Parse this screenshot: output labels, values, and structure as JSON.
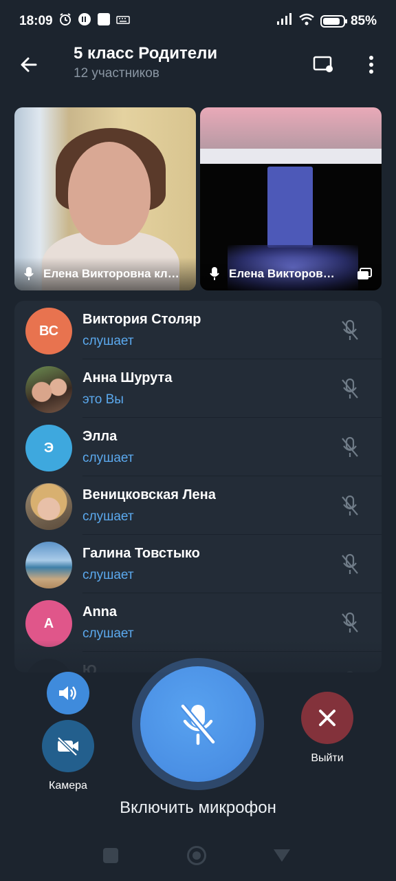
{
  "status_bar": {
    "time": "18:09",
    "battery_pct": "85%",
    "battery_level": 0.85
  },
  "header": {
    "title": "5 класс Родители",
    "subtitle": "12 участников"
  },
  "video_tiles": [
    {
      "name": "Елена Викторовна кл…"
    },
    {
      "name": "Елена Викторов…"
    }
  ],
  "participants": [
    {
      "initials": "ВС",
      "name": "Виктория Столяр",
      "status": "слушает",
      "avatar_color": "#e8734f"
    },
    {
      "initials": "",
      "name": "Анна Шурута",
      "status": "это Вы",
      "avatar_color": "#6a5a52"
    },
    {
      "initials": "Э",
      "name": "Элла",
      "status": "слушает",
      "avatar_color": "#3ea8de"
    },
    {
      "initials": "",
      "name": "Веницковская Лена",
      "status": "слушает",
      "avatar_color": "#b89a80"
    },
    {
      "initials": "",
      "name": "Галина Товстыко",
      "status": "слушает",
      "avatar_color": "#5a8bb8"
    },
    {
      "initials": "A",
      "name": "Anna",
      "status": "слушает",
      "avatar_color": "#e0568a"
    },
    {
      "initials": "",
      "name": "Ю",
      "status": "",
      "avatar_color": "#1a1f26"
    }
  ],
  "controls": {
    "camera_label": "Камера",
    "leave_label": "Выйти",
    "mic_caption": "Включить микрофон"
  },
  "colors": {
    "background": "#1c242e",
    "panel": "#232c37",
    "accent_blue": "#4a8fe4",
    "status_blue": "#5ba9ee",
    "leave_red": "#83323b"
  }
}
